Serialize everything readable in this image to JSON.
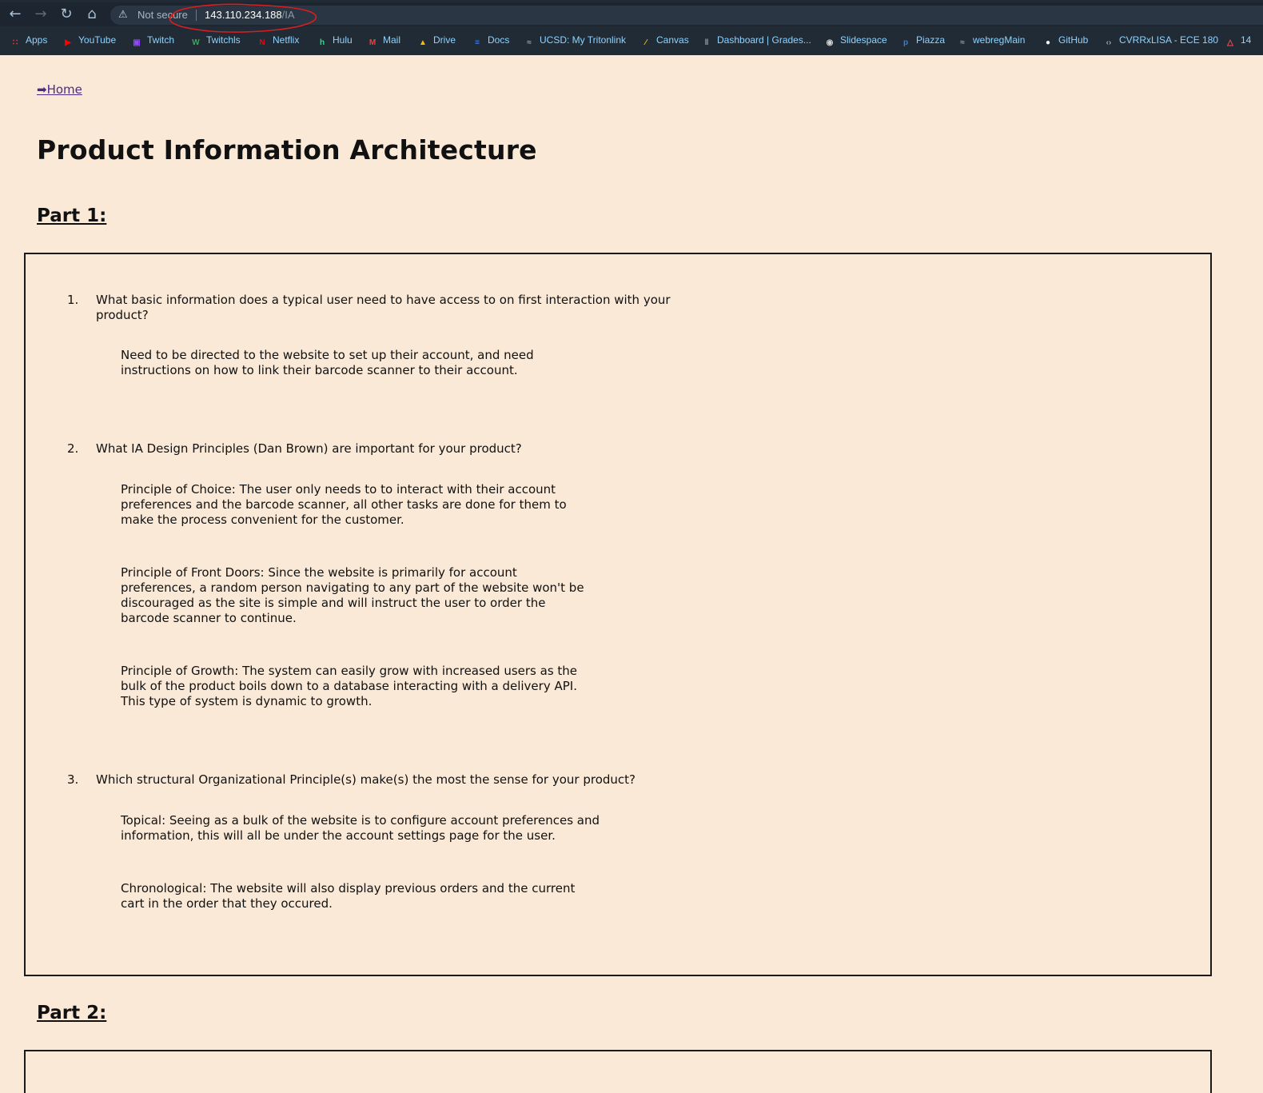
{
  "browser": {
    "security_label": "Not secure",
    "url_host": "143.110.234.188",
    "url_path": "/IA",
    "bookmarks": [
      {
        "label": "Apps",
        "icon": "apps-grid-icon",
        "color": "#e8453c"
      },
      {
        "label": "YouTube",
        "icon": "youtube-icon",
        "color": "#ff0000"
      },
      {
        "label": "Twitch",
        "icon": "twitch-icon",
        "color": "#9146ff"
      },
      {
        "label": "Twitchls",
        "icon": "twitchls-icon",
        "color": "#3aa757"
      },
      {
        "label": "Netflix",
        "icon": "netflix-icon",
        "color": "#e50914"
      },
      {
        "label": "Hulu",
        "icon": "hulu-icon",
        "color": "#1ce783"
      },
      {
        "label": "Mail",
        "icon": "gmail-icon",
        "color": "#ea4335"
      },
      {
        "label": "Drive",
        "icon": "drive-icon",
        "color": "#fbbc04"
      },
      {
        "label": "Docs",
        "icon": "docs-icon",
        "color": "#4285f4"
      },
      {
        "label": "UCSD: My Tritonlink",
        "icon": "tritonlink-icon",
        "color": "#9aa5b1"
      },
      {
        "label": "Canvas",
        "icon": "canvas-icon",
        "color": "#f5c518"
      },
      {
        "label": "Dashboard | Grades...",
        "icon": "dashboard-icon",
        "color": "#9aa5b1"
      },
      {
        "label": "Slidespace",
        "icon": "slidespace-icon",
        "color": "#d0d0d0"
      },
      {
        "label": "Piazza",
        "icon": "piazza-icon",
        "color": "#3e7ec8"
      },
      {
        "label": "webregMain",
        "icon": "webreg-icon",
        "color": "#9aa5b1"
      },
      {
        "label": "GitHub",
        "icon": "github-icon",
        "color": "#ffffff"
      },
      {
        "label": "CVRRxLISA - ECE 180",
        "icon": "code-icon",
        "color": "#9aa5b1"
      },
      {
        "label": "14",
        "icon": "bookmark-icon",
        "color": "#ff4b4b"
      }
    ]
  },
  "page": {
    "home_link": "➡Home",
    "title": "Product Information Architecture",
    "part1_heading": "Part 1:",
    "part2_heading": "Part 2:",
    "questions": [
      {
        "number": "1.",
        "text": "What basic information does a typical user need to have access to on first interaction with your product?",
        "answers": [
          "Need to be directed to the website to set up their account, and need instructions on how to link their barcode scanner to their account."
        ]
      },
      {
        "number": "2.",
        "text": "What IA Design Principles (Dan Brown) are important for your product?",
        "answers": [
          "Principle of Choice: The user only needs to to interact with their account preferences and the barcode scanner, all other tasks are done for them to make the process convenient for the customer.",
          "Principle of Front Doors: Since the website is primarily for account preferences, a random person navigating to any part of the website won't be discouraged as the site is simple and will instruct the user to order the barcode scanner to continue.",
          "Principle of Growth: The system can easily grow with increased users as the bulk of the product boils down to a database interacting with a delivery API. This type of system is dynamic to growth."
        ]
      },
      {
        "number": "3.",
        "text": "Which structural Organizational Principle(s) make(s) the most the sense for your product?",
        "answers": [
          "Topical: Seeing as a bulk of the website is to configure account preferences and information, this will all be under the account settings page for the user.",
          "Chronological: The website will also display previous orders and the current cart in the order that they occured."
        ]
      }
    ]
  },
  "colors": {
    "page_background": "#fae9d6",
    "chrome_background": "#202b36",
    "bookmark_text": "#8fd3ff",
    "link": "#4a2a88",
    "annotation_circle": "#d42020"
  }
}
